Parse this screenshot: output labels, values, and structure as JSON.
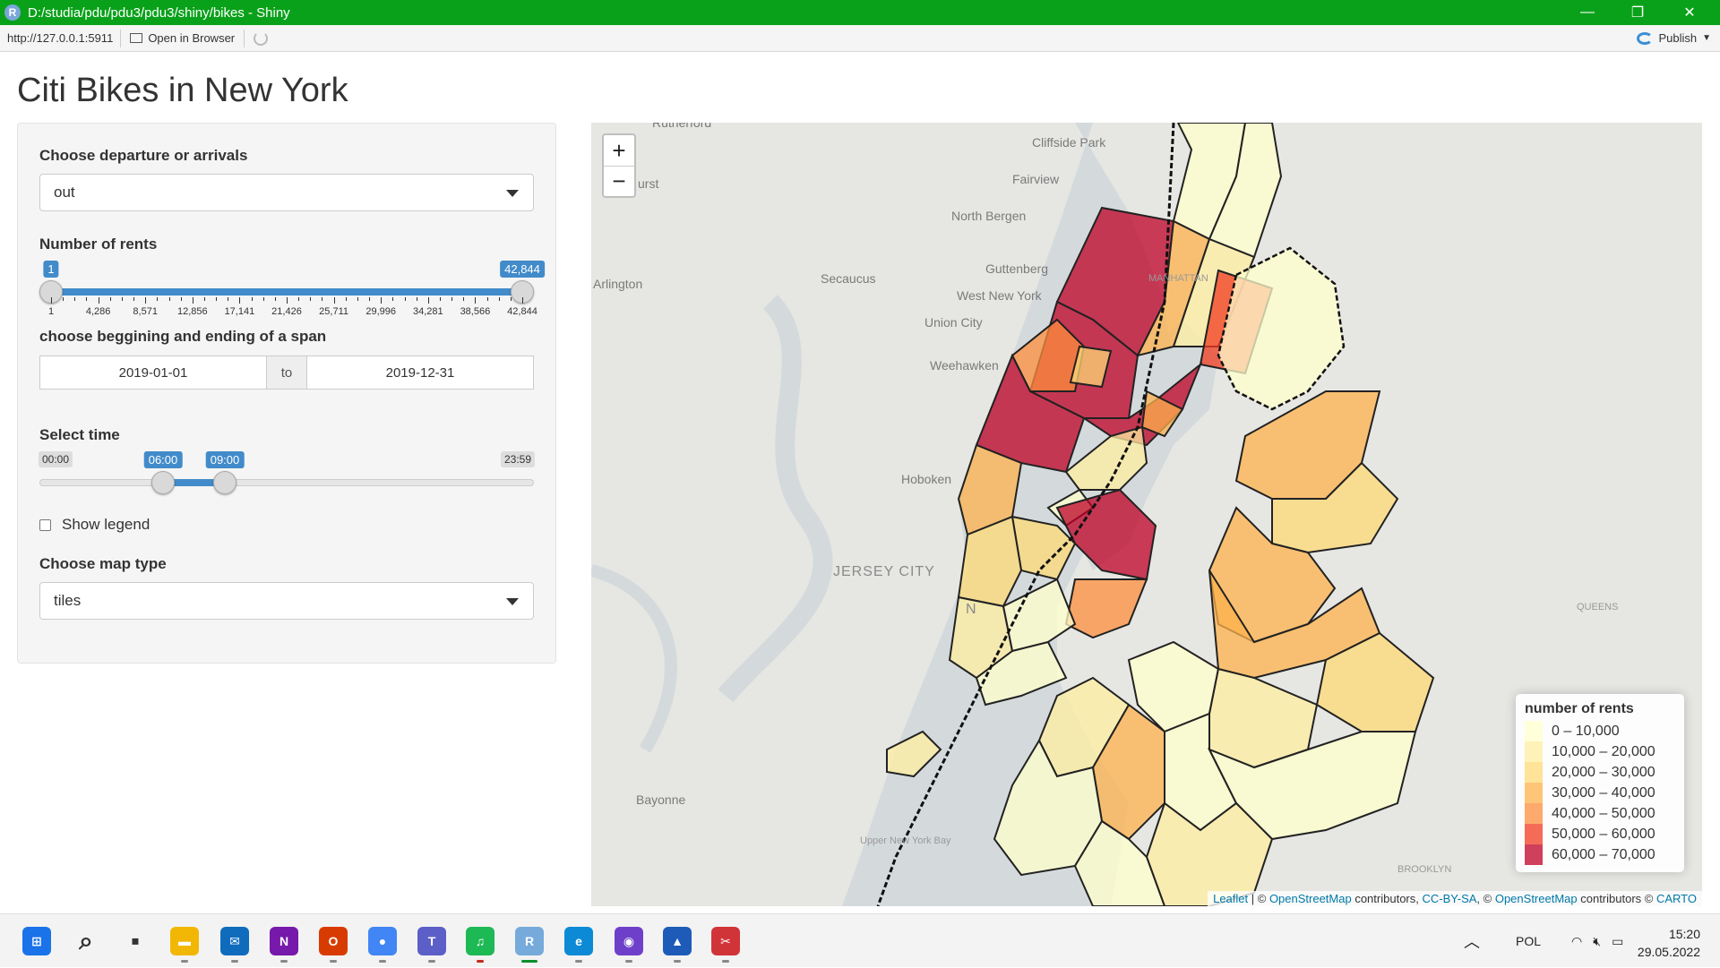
{
  "window": {
    "title": "D:/studia/pdu/pdu3/pdu3/shiny/bikes - Shiny",
    "app_icon_letter": "R"
  },
  "addressbar": {
    "url": "http://127.0.0.1:5911",
    "open_label": "Open in Browser",
    "publish_label": "Publish"
  },
  "app": {
    "title": "Citi Bikes in New York",
    "direction": {
      "label": "Choose departure or arrivals",
      "value": "out"
    },
    "rents": {
      "label": "Number of rents",
      "min_label": "1",
      "max_label": "42,844",
      "from": "1",
      "to": "42,844",
      "range_fraction": [
        0,
        1
      ],
      "ticks": [
        "1",
        "4,286",
        "8,571",
        "12,856",
        "17,141",
        "21,426",
        "25,711",
        "29,996",
        "34,281",
        "38,566",
        "42,844"
      ]
    },
    "span": {
      "label": "choose beggining and ending of a span",
      "start": "2019-01-01",
      "sep": "to",
      "end": "2019-12-31"
    },
    "time": {
      "label": "Select time",
      "min": "00:00",
      "max": "23:59",
      "from": "06:00",
      "to": "09:00",
      "range_fraction": [
        0.25,
        0.375
      ]
    },
    "legend_toggle": {
      "label": "Show legend",
      "checked": false
    },
    "maptype": {
      "label": "Choose map type",
      "value": "tiles"
    }
  },
  "map": {
    "zoom_in": "+",
    "zoom_out": "−",
    "places": [
      {
        "name": "Rutherford"
      },
      {
        "name": "Cliffside Park"
      },
      {
        "name": "Fairview"
      },
      {
        "name": "North Bergen"
      },
      {
        "name": "Guttenberg"
      },
      {
        "name": "West New York"
      },
      {
        "name": "Union City"
      },
      {
        "name": "Weehawken"
      },
      {
        "name": "Secaucus"
      },
      {
        "name": "Arlington"
      },
      {
        "name": "Hoboken"
      },
      {
        "name": "JERSEY CITY"
      },
      {
        "name": "Bayonne"
      },
      {
        "name": "Upper New York Bay"
      },
      {
        "name": "QUEENS"
      },
      {
        "name": "BROOKLYN"
      },
      {
        "name": "urst"
      },
      {
        "name": "N"
      },
      {
        "name": "MANHATTAN"
      }
    ],
    "legend": {
      "title": "number of rents",
      "items": [
        {
          "label": "0 – 10,000",
          "color": "#ffffcc"
        },
        {
          "label": "10,000 – 20,000",
          "color": "#ffeda0"
        },
        {
          "label": "20,000 – 30,000",
          "color": "#fed976"
        },
        {
          "label": "30,000 – 40,000",
          "color": "#feb24c"
        },
        {
          "label": "40,000 – 50,000",
          "color": "#fd8d3c"
        },
        {
          "label": "50,000 – 60,000",
          "color": "#f03b20"
        },
        {
          "label": "60,000 – 70,000",
          "color": "#bd0026"
        }
      ]
    },
    "attribution": {
      "leaflet": "Leaflet",
      "sep1": " | © ",
      "osm": "OpenStreetMap",
      "contrib1": " contributors, ",
      "ccbysa": "CC-BY-SA",
      "sep2": ", © ",
      "osm2": "OpenStreetMap",
      "contrib2": " contributors © ",
      "carto": "CARTO"
    }
  },
  "taskbar": {
    "apps": [
      {
        "name": "start",
        "glyph": "⊞",
        "color": "#1a73e8"
      },
      {
        "name": "search",
        "glyph": "⌕",
        "color": "#333333"
      },
      {
        "name": "task-view",
        "glyph": "▪",
        "color": "#333333"
      },
      {
        "name": "file-explorer",
        "glyph": "▬",
        "color": "#f2b705"
      },
      {
        "name": "mail",
        "glyph": "✉",
        "color": "#0f6cbd"
      },
      {
        "name": "onenote",
        "glyph": "N",
        "color": "#7719aa"
      },
      {
        "name": "office",
        "glyph": "O",
        "color": "#d83b01"
      },
      {
        "name": "chrome",
        "glyph": "●",
        "color": "#4285f4"
      },
      {
        "name": "teams",
        "glyph": "T",
        "color": "#5b5fc7"
      },
      {
        "name": "spotify",
        "glyph": "♫",
        "color": "#1db954"
      },
      {
        "name": "rstudio",
        "glyph": "R",
        "color": "#75aadb"
      },
      {
        "name": "edge",
        "glyph": "e",
        "color": "#0c8ad6"
      },
      {
        "name": "github",
        "glyph": "◉",
        "color": "#6e40c9"
      },
      {
        "name": "photos",
        "glyph": "▲",
        "color": "#1e5bb8"
      },
      {
        "name": "snipping-tool",
        "glyph": "✂",
        "color": "#d13438"
      }
    ],
    "lang": "POL",
    "time": "15:20",
    "date": "29.05.2022"
  }
}
